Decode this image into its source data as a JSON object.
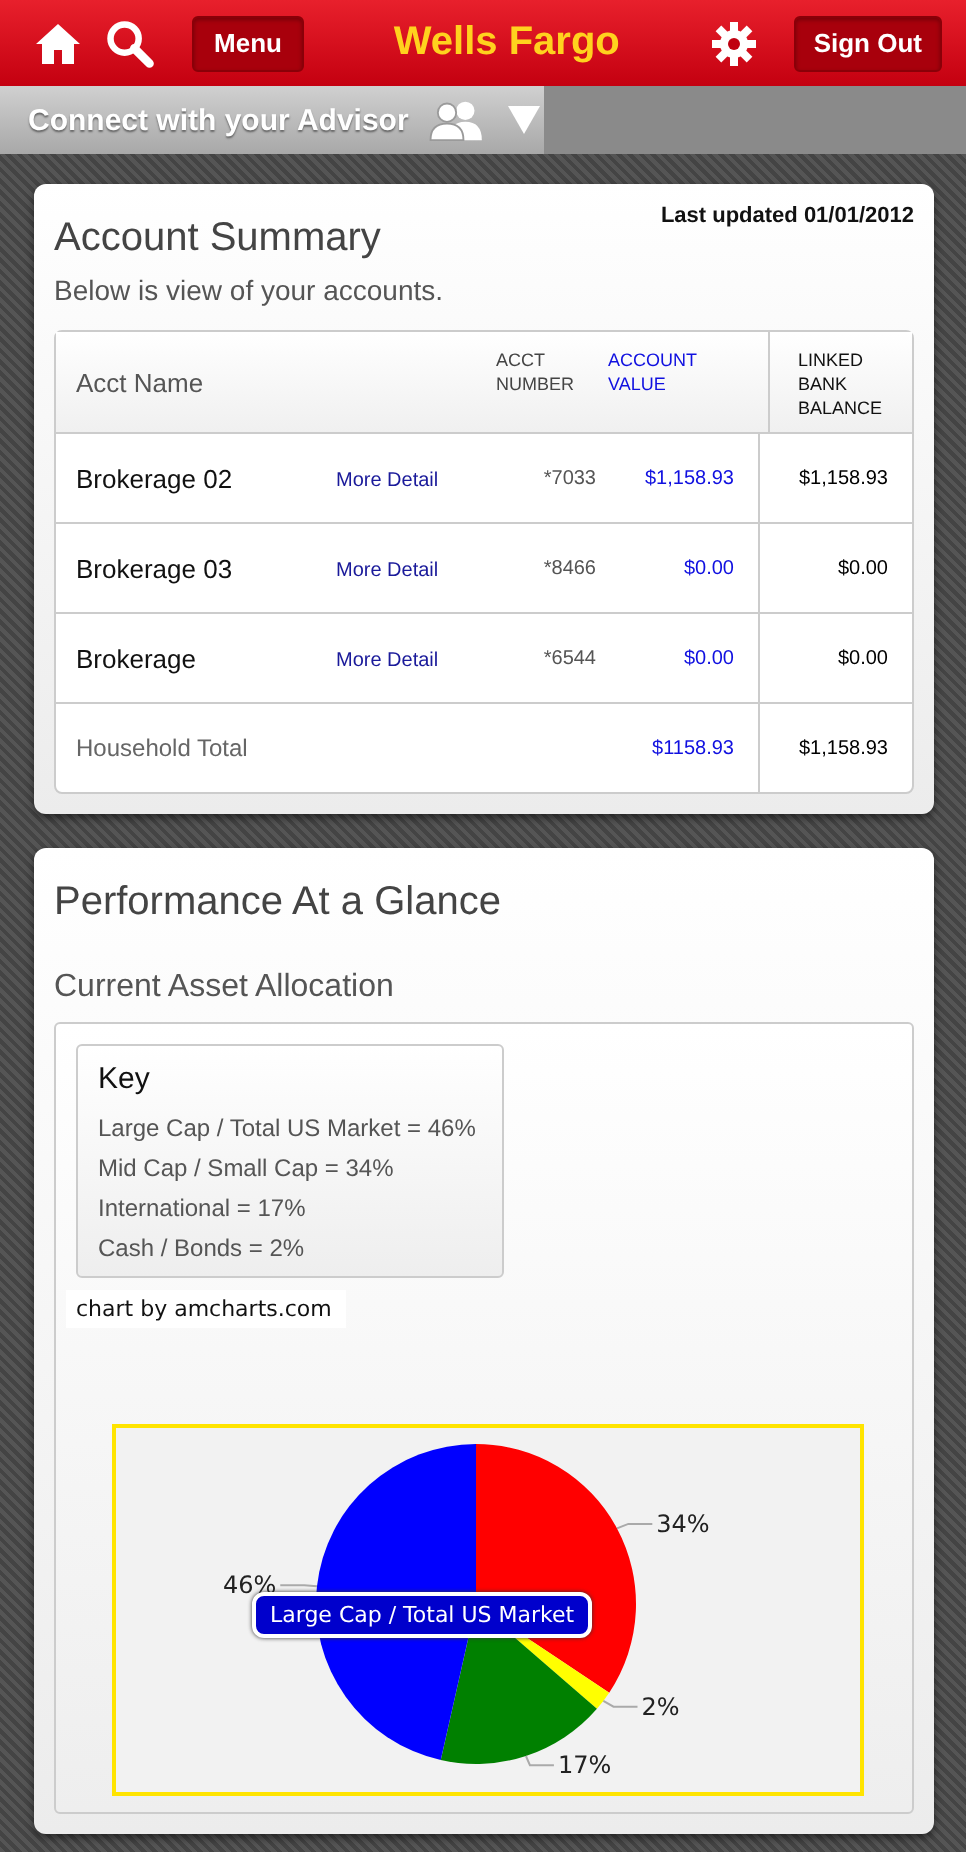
{
  "header": {
    "menu_button": "Menu",
    "title": "Wells Fargo",
    "sign_out_button": "Sign Out"
  },
  "advisor_bar": {
    "label": "Connect with your Advisor"
  },
  "account_summary": {
    "title": "Account Summary",
    "last_updated": "Last updated 01/01/2012",
    "subtitle": "Below is view of your accounts.",
    "columns": [
      "Acct Name",
      "ACCT NUMBER",
      "ACCOUNT VALUE",
      "LINKED BANK BALANCE"
    ],
    "rows": [
      {
        "name": "Brokerage 02",
        "link": "More Detail",
        "number": "*7033",
        "value": "$1,158.93",
        "balance": "$1,158.93"
      },
      {
        "name": "Brokerage 03",
        "link": "More Detail",
        "number": "*8466",
        "value": "$0.00",
        "balance": "$0.00"
      },
      {
        "name": "Brokerage",
        "link": "More Detail",
        "number": "*6544",
        "value": "$0.00",
        "balance": "$0.00"
      }
    ],
    "total": {
      "label": "Household Total",
      "value": "$1158.93",
      "balance": "$1,158.93"
    }
  },
  "performance": {
    "title": "Performance At a Glance",
    "subtitle": "Current Asset Allocation",
    "key": {
      "title": "Key",
      "items": [
        "Large Cap / Total US Market = 46%",
        "Mid Cap / Small Cap = 34%",
        "International = 17%",
        "Cash / Bonds = 2%"
      ]
    },
    "credit": "chart by amcharts.com",
    "tooltip": "Large Cap / Total US Market",
    "chart_data": {
      "type": "pie",
      "series": [
        {
          "color": [
            "#ff0000",
            "#ffff00",
            "#008000",
            "#0000ff"
          ],
          "values": [
            34,
            2,
            17,
            46
          ]
        }
      ],
      "value_labels": [
        "34%",
        "2%",
        "17%",
        "46%"
      ]
    }
  }
}
